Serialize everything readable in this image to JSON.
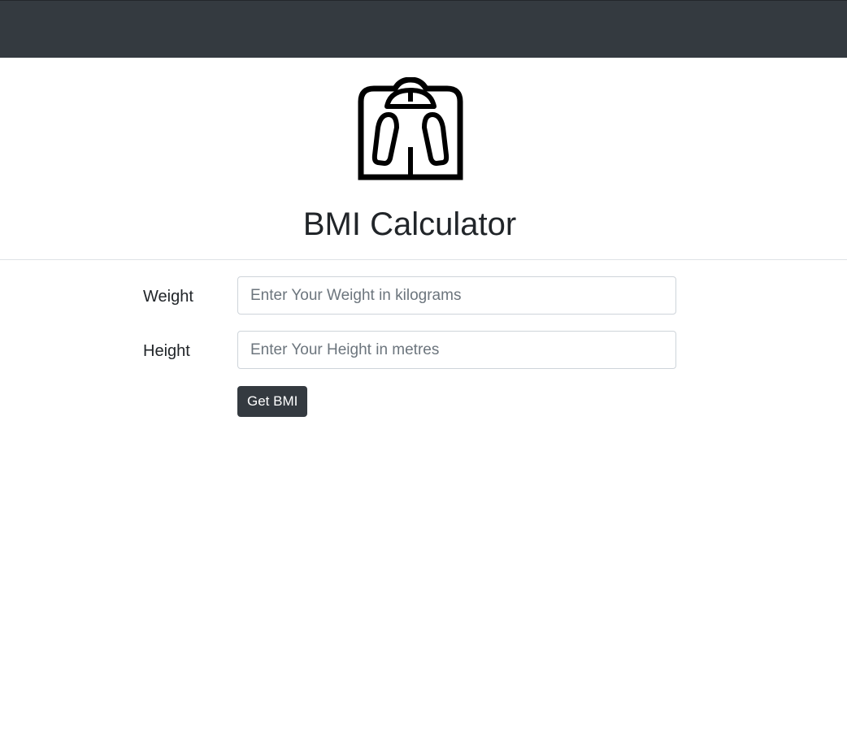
{
  "header": {
    "color": "#343a40"
  },
  "logo": {
    "icon": "bathroom-scale-icon"
  },
  "page": {
    "title": "BMI Calculator"
  },
  "form": {
    "weight": {
      "label": "Weight",
      "placeholder": "Enter Your Weight in kilograms",
      "value": ""
    },
    "height": {
      "label": "Height",
      "placeholder": "Enter Your Height in metres",
      "value": ""
    },
    "submit_label": "Get BMI"
  }
}
